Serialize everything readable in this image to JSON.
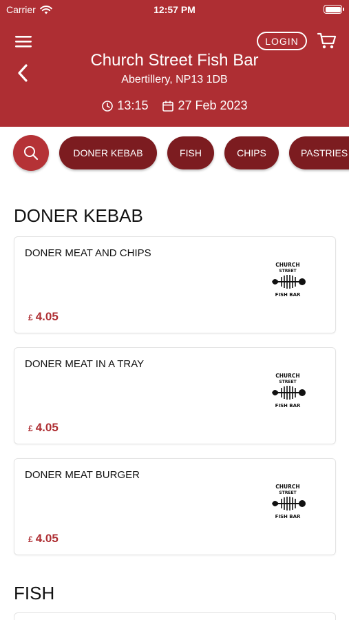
{
  "status": {
    "carrier": "Carrier",
    "time": "12:57 PM"
  },
  "header": {
    "login_label": "LOGIN",
    "store_name": "Church Street Fish Bar",
    "address": "Abertillery, NP13 1DB",
    "order_time": "13:15",
    "order_date": "27 Feb 2023",
    "background_color": "#ae2e33"
  },
  "categories": [
    "DONER KEBAB",
    "FISH",
    "CHIPS",
    "PASTRIES"
  ],
  "sections": [
    {
      "title": "DONER KEBAB",
      "items": [
        {
          "name": "DONER MEAT AND CHIPS",
          "currency": "£",
          "price": "4.05"
        },
        {
          "name": "DONER MEAT IN A TRAY",
          "currency": "£",
          "price": "4.05"
        },
        {
          "name": "DONER MEAT BURGER",
          "currency": "£",
          "price": "4.05"
        }
      ]
    },
    {
      "title": "FISH",
      "items": []
    }
  ],
  "logo": {
    "top_text": "CHURCH",
    "mid_text": "STREET",
    "bottom_text": "FISH BAR"
  },
  "colors": {
    "accent": "#ae2e33",
    "chip": "#7c1c20",
    "price": "#ae2e33"
  },
  "icons": [
    "menu-icon",
    "back-icon",
    "cart-icon",
    "clock-icon",
    "calendar-icon",
    "search-icon",
    "wifi-icon",
    "battery-icon"
  ]
}
